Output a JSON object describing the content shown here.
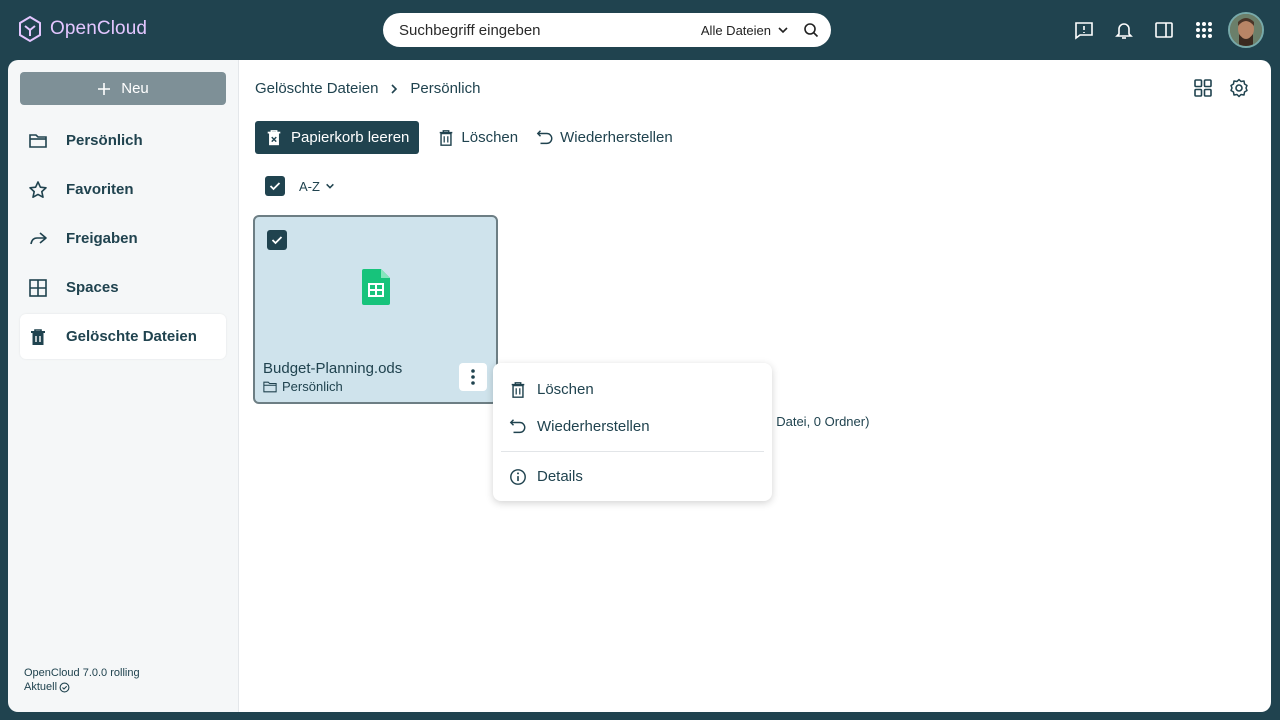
{
  "app": {
    "name": "OpenCloud",
    "brand_color": "#20434f",
    "logo_color": "#e3c6ff"
  },
  "search": {
    "placeholder": "Suchbegriff eingeben",
    "scope": "Alle Dateien"
  },
  "topbar": {
    "icons": [
      "feedback-icon",
      "bell-icon",
      "sidebar-toggle-icon",
      "app-grid-icon"
    ],
    "avatar": "user-avatar"
  },
  "sidebar": {
    "new_label": "Neu",
    "items": [
      {
        "label": "Persönlich",
        "icon": "folder-icon",
        "active": false
      },
      {
        "label": "Favoriten",
        "icon": "star-icon",
        "active": false
      },
      {
        "label": "Freigaben",
        "icon": "share-icon",
        "active": false
      },
      {
        "label": "Spaces",
        "icon": "spaces-icon",
        "active": false
      },
      {
        "label": "Gelöschte Dateien",
        "icon": "trash-icon",
        "active": true
      }
    ],
    "version": "OpenCloud 7.0.0 rolling",
    "status": "Aktuell"
  },
  "breadcrumb": {
    "items": [
      "Gelöschte Dateien",
      "Persönlich"
    ]
  },
  "actions": {
    "empty_trash": "Papierkorb leeren",
    "delete": "Löschen",
    "restore": "Wiederherstellen"
  },
  "sort": {
    "label": "A-Z"
  },
  "tile": {
    "name": "Budget-Planning.ods",
    "location": "Persönlich",
    "selected": true,
    "file_color": "#17c37b"
  },
  "summary": ". Datei, 0 Ordner)",
  "context_menu": {
    "delete": "Löschen",
    "restore": "Wiederherstellen",
    "details": "Details"
  }
}
